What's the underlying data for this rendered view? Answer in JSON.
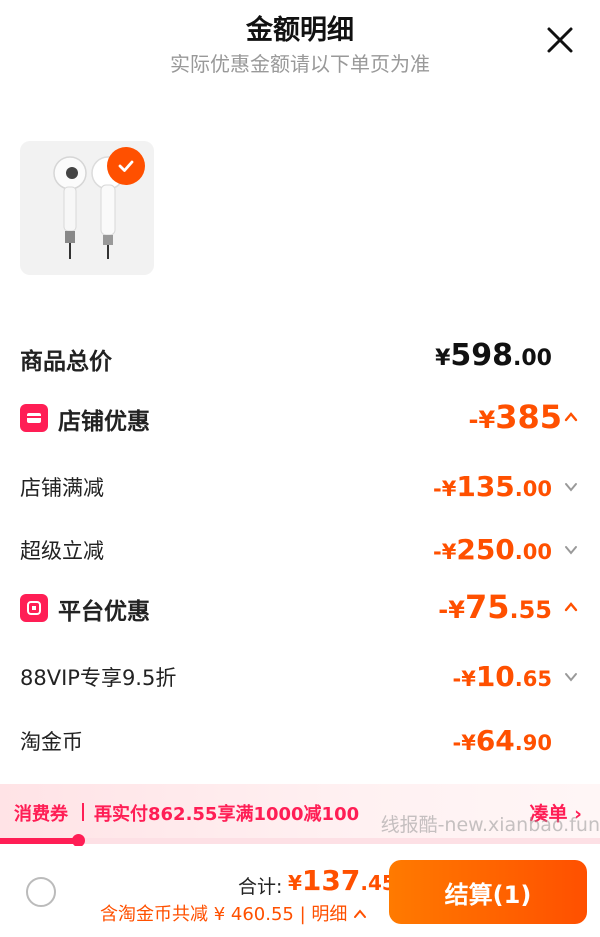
{
  "header": {
    "title": "金额明细",
    "subtitle": "实际优惠金额请以下单页为准"
  },
  "product": {
    "selected": true
  },
  "summary": {
    "total_label": "商品总价",
    "total": {
      "sym": "¥",
      "int": "598",
      "dec": ".00"
    }
  },
  "shop_discount": {
    "label": "店铺优惠",
    "amount": {
      "sym": "-¥",
      "int": "385",
      "dec": ""
    },
    "items": [
      {
        "label": "店铺满减",
        "amount": {
          "sym": "-¥",
          "int": "135",
          "dec": ".00"
        }
      },
      {
        "label": "超级立减",
        "amount": {
          "sym": "-¥",
          "int": "250",
          "dec": ".00"
        }
      }
    ]
  },
  "platform_discount": {
    "label": "平台优惠",
    "amount": {
      "sym": "-¥",
      "int": "75",
      "dec": ".55"
    },
    "items": [
      {
        "label": "88VIP专享9.5折",
        "amount": {
          "sym": "-¥",
          "int": "10",
          "dec": ".65"
        }
      },
      {
        "label": "淘金币",
        "amount": {
          "sym": "-¥",
          "int": "64",
          "dec": ".90"
        }
      }
    ]
  },
  "coupon": {
    "tag": "消费券",
    "text": "再实付862.55享满1000减100",
    "link": "凑单",
    "progress": 0.13
  },
  "watermark": "线报酷-new.xianbao.fun",
  "footer": {
    "sum_label": "合计:",
    "sum": {
      "sym": "¥",
      "int": "137",
      "dec": ".45"
    },
    "saving": "含淘金币共减 ¥ 460.55 | 明细",
    "checkout_label": "结算(1)"
  },
  "colors": {
    "accent": "#ff5000",
    "coupon": "#ff1e55"
  }
}
